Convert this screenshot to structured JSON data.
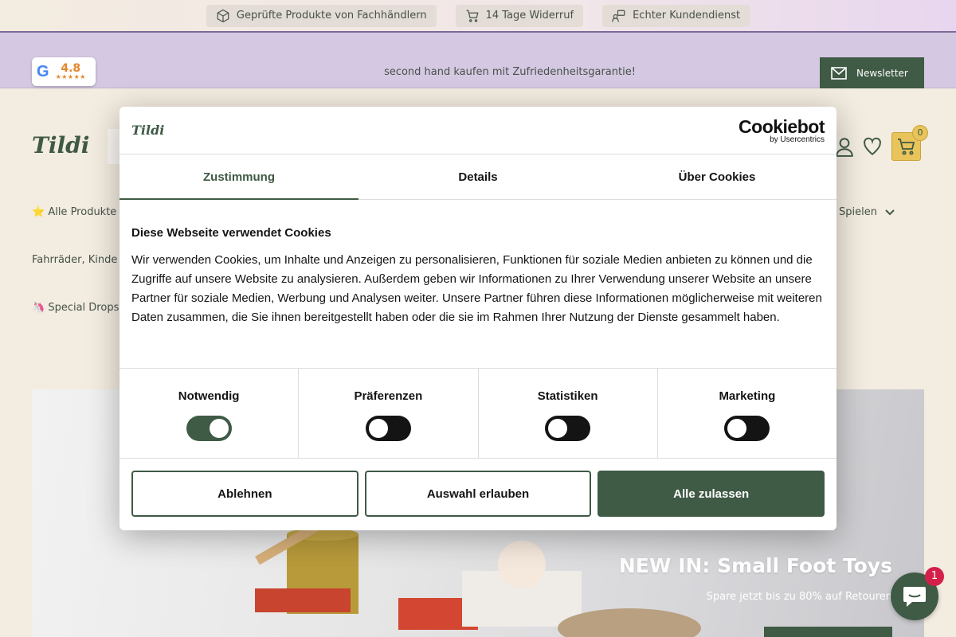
{
  "trust_bar": {
    "items": [
      {
        "label": "Geprüfte Produkte von Fachhändlern",
        "icon": "box-icon"
      },
      {
        "label": "14 Tage Widerruf",
        "icon": "cart-icon"
      },
      {
        "label": "Echter Kundendienst",
        "icon": "support-icon"
      }
    ]
  },
  "announcement": {
    "google_rating": "4.8",
    "google_stars": "★★★★★",
    "promo_text": "second hand kaufen mit Zufriedenheitsgarantie!",
    "newsletter_label": "Newsletter"
  },
  "header": {
    "logo_text": "Tildi",
    "cart_count": "0"
  },
  "nav": {
    "all_products": "⭐ Alle Produkte",
    "games_label": "Spielen",
    "bikes_label": "Fahrräder, Kinde",
    "special_drops": "🦄 Special Drops"
  },
  "hero": {
    "title": "NEW IN: Small Foot Toys",
    "subtitle": "Spare jetzt bis zu 80% auf Retouren"
  },
  "cookie_dialog": {
    "logo_text": "Tildi",
    "brand_main": "Cookiebot",
    "brand_sub": "by Usercentrics",
    "tabs": [
      {
        "label": "Zustimmung",
        "active": true
      },
      {
        "label": "Details",
        "active": false
      },
      {
        "label": "Über Cookies",
        "active": false
      }
    ],
    "heading": "Diese Webseite verwendet Cookies",
    "body": "Wir verwenden Cookies, um Inhalte und Anzeigen zu personalisieren, Funktionen für soziale Medien anbieten zu können und die Zugriffe auf unsere Website zu analysieren. Außerdem geben wir Informationen zu Ihrer Verwendung unserer Website an unsere Partner für soziale Medien, Werbung und Analysen weiter. Unsere Partner führen diese Informationen möglicherweise mit weiteren Daten zusammen, die Sie ihnen bereitgestellt haben oder die sie im Rahmen Ihrer Nutzung der Dienste gesammelt haben.",
    "toggles": [
      {
        "label": "Notwendig",
        "on": true
      },
      {
        "label": "Präferenzen",
        "on": false
      },
      {
        "label": "Statistiken",
        "on": false
      },
      {
        "label": "Marketing",
        "on": false
      }
    ],
    "buttons": {
      "reject": "Ablehnen",
      "allow_selection": "Auswahl erlauben",
      "allow_all": "Alle zulassen"
    }
  },
  "chat": {
    "unread_count": "1"
  },
  "colors": {
    "brand_green": "#3f5a45",
    "accent_yellow": "#e8c45a",
    "band_purple": "#d5c8e2",
    "badge_red": "#d3204a"
  }
}
